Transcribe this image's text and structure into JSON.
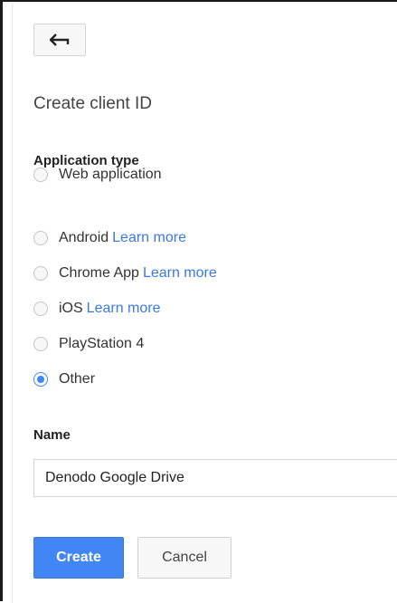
{
  "back_button": {
    "icon": "arrow-left-icon"
  },
  "title": "Create client ID",
  "application_type": {
    "label": "Application type",
    "options": [
      {
        "label": "Web application",
        "link": "",
        "checked": false
      },
      {
        "label": "Android",
        "link": "Learn more",
        "checked": false
      },
      {
        "label": "Chrome App",
        "link": "Learn more",
        "checked": false
      },
      {
        "label": "iOS",
        "link": "Learn more",
        "checked": false
      },
      {
        "label": "PlayStation 4",
        "link": "",
        "checked": false
      },
      {
        "label": "Other",
        "link": "",
        "checked": true
      }
    ]
  },
  "name_field": {
    "label": "Name",
    "value": "Denodo Google Drive"
  },
  "actions": {
    "create_label": "Create",
    "cancel_label": "Cancel"
  },
  "colors": {
    "primary": "#4285f4",
    "link": "#3b78e7"
  }
}
